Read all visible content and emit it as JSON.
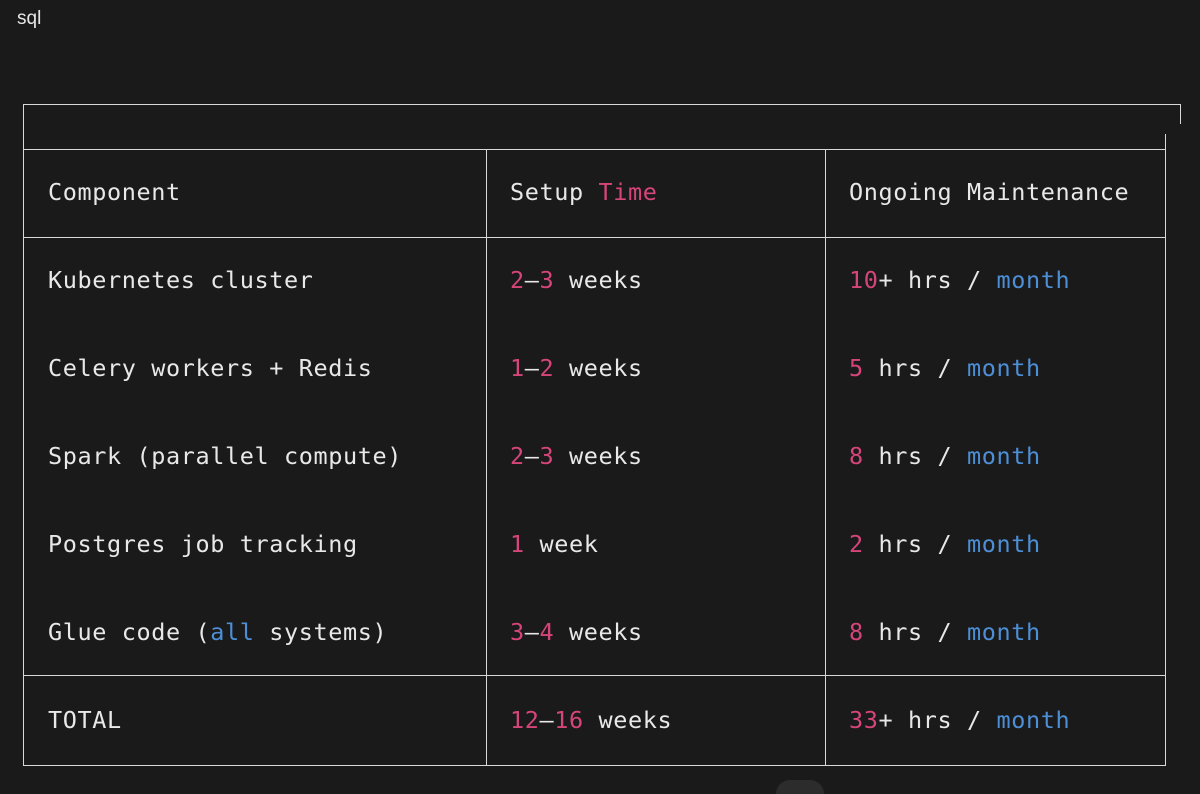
{
  "code_block": {
    "language": "sql"
  },
  "table": {
    "headers": {
      "component": "Component",
      "setup": [
        "Setup ",
        "Time"
      ],
      "maintenance": "Ongoing Maintenance"
    },
    "rows": [
      {
        "component": [
          "Kubernetes cluster"
        ],
        "setup": [
          "2",
          "—",
          "3",
          " weeks"
        ],
        "maint": [
          "10",
          "+ hrs / ",
          "month"
        ]
      },
      {
        "component": [
          "Celery workers + Redis"
        ],
        "setup": [
          "1",
          "—",
          "2",
          " weeks"
        ],
        "maint": [
          "5",
          " hrs / ",
          "month"
        ]
      },
      {
        "component": [
          "Spark (parallel compute)"
        ],
        "setup": [
          "2",
          "—",
          "3",
          " weeks"
        ],
        "maint": [
          "8",
          " hrs / ",
          "month"
        ]
      },
      {
        "component": [
          "Postgres job tracking"
        ],
        "setup": [
          "1",
          " week"
        ],
        "maint": [
          "2",
          " hrs / ",
          "month"
        ]
      },
      {
        "component": [
          "Glue code (",
          "all",
          " systems)"
        ],
        "setup": [
          "3",
          "—",
          "4",
          " weeks"
        ],
        "maint": [
          "8",
          " hrs / ",
          "month"
        ]
      }
    ],
    "total": {
      "component": "TOTAL",
      "setup": [
        "12",
        "—",
        "16",
        " weeks"
      ],
      "maint": [
        "33",
        "+ hrs / ",
        "month"
      ]
    }
  },
  "colors": {
    "background": "#1a1a1a",
    "text": "#e8e8e8",
    "number": "#d6457a",
    "keyword": "#4d8fd6",
    "border": "#d8d8d8"
  }
}
